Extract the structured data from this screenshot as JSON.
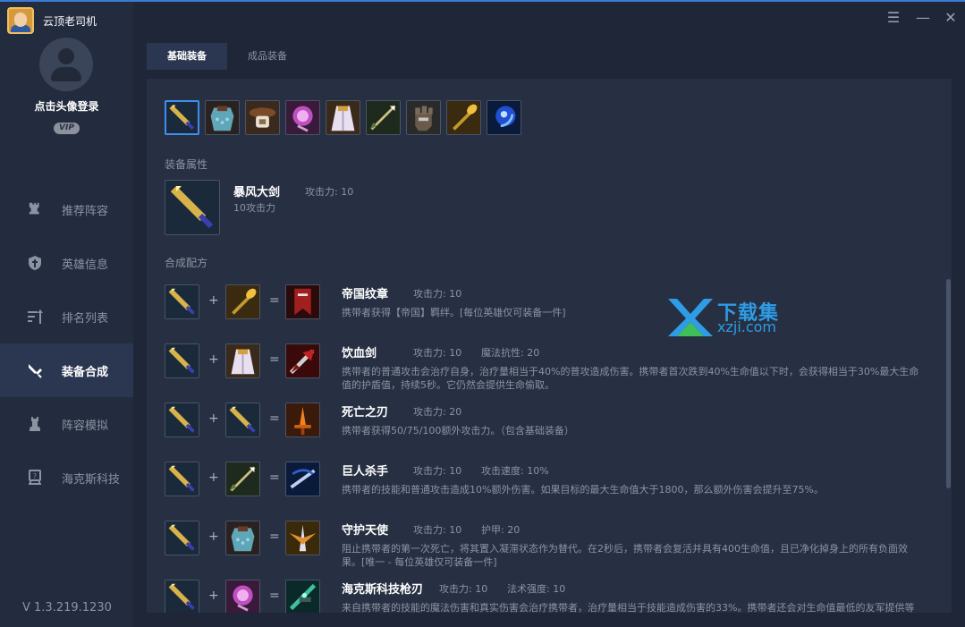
{
  "app": {
    "title": "云顶老司机",
    "login_text": "点击头像登录",
    "vip": "VIP",
    "version": "V 1.3.219.1230"
  },
  "nav": {
    "items": [
      {
        "label": "推荐阵容",
        "icon": "chess-rook-icon"
      },
      {
        "label": "英雄信息",
        "icon": "helmet-icon"
      },
      {
        "label": "排名列表",
        "icon": "ranking-icon"
      },
      {
        "label": "装备合成",
        "icon": "sword-icon",
        "active": true
      },
      {
        "label": "阵容模拟",
        "icon": "chess-tower-icon"
      },
      {
        "label": "海克斯科技",
        "icon": "hextech-icon"
      }
    ]
  },
  "tabs": [
    {
      "label": "基础装备",
      "active": true
    },
    {
      "label": "成品装备",
      "active": false
    }
  ],
  "item_strip": [
    {
      "name": "sword",
      "selected": true
    },
    {
      "name": "chain-vest"
    },
    {
      "name": "belt"
    },
    {
      "name": "tear"
    },
    {
      "name": "cloak"
    },
    {
      "name": "bow"
    },
    {
      "name": "gloves"
    },
    {
      "name": "spatula"
    },
    {
      "name": "rod"
    }
  ],
  "attributes": {
    "section_label": "装备属性",
    "name": "暴风大剑",
    "stat": "攻击力: 10",
    "desc": "10攻击力"
  },
  "recipes_section_label": "合成配方",
  "recipes": [
    {
      "a": "sword",
      "b": "spatula",
      "result": "banner",
      "name": "帝国纹章",
      "stat1": "攻击力: 10",
      "stat2": "",
      "desc": "携带者获得【帝国】羁绊。[每位英雄仅可装备一件]"
    },
    {
      "a": "sword",
      "b": "cloak",
      "result": "bloodthirster",
      "name": "饮血剑",
      "stat1": "攻击力: 10",
      "stat2": "魔法抗性: 20",
      "desc": "携带者的普通攻击会治疗自身，治疗量相当于40%的普攻造成伤害。携带者首次跌到40%生命值以下时，会获得相当于30%最大生命值的护盾值，持续5秒。它仍然会提供生命偷取。"
    },
    {
      "a": "sword",
      "b": "sword",
      "result": "deathblade",
      "name": "死亡之刃",
      "stat1": "攻击力: 20",
      "stat2": "",
      "desc": "携带者获得50/75/100额外攻击力。（包含基础装备）"
    },
    {
      "a": "sword",
      "b": "bow",
      "result": "giantslayer",
      "name": "巨人杀手",
      "stat1": "攻击力: 10",
      "stat2": "攻击速度: 10%",
      "desc": "携带者的技能和普通攻击造成10%额外伤害。如果目标的最大生命值大于1800，那么额外伤害会提升至75%。"
    },
    {
      "a": "sword",
      "b": "chain-vest",
      "result": "guardian-angel",
      "name": "守护天使",
      "stat1": "攻击力: 10",
      "stat2": "护甲: 20",
      "desc": "阻止携带者的第一次死亡，将其置入凝滞状态作为替代。在2秒后，携带者会复活并具有400生命值，且已净化掉身上的所有负面效果。[唯一 - 每位英雄仅可装备一件]"
    },
    {
      "a": "sword",
      "b": "tear",
      "result": "hextech-gunblade",
      "name": "海克斯科技枪刃",
      "stat1": "攻击力: 10",
      "stat2": "法术强度: 10",
      "desc": "来自携带者的技能的魔法伤害和真实伤害会治疗携带者，治疗量相当于技能造成伤害的33%。携带者还会对生命值最低的友军提供等额的治疗效果。"
    }
  ],
  "watermark": {
    "cn": "下载集",
    "en": "xzji.com"
  },
  "colors": {
    "accent": "#3d8ef0",
    "sidebar": "#232c3e",
    "panel": "#273042",
    "text_muted": "#8b93a3"
  }
}
